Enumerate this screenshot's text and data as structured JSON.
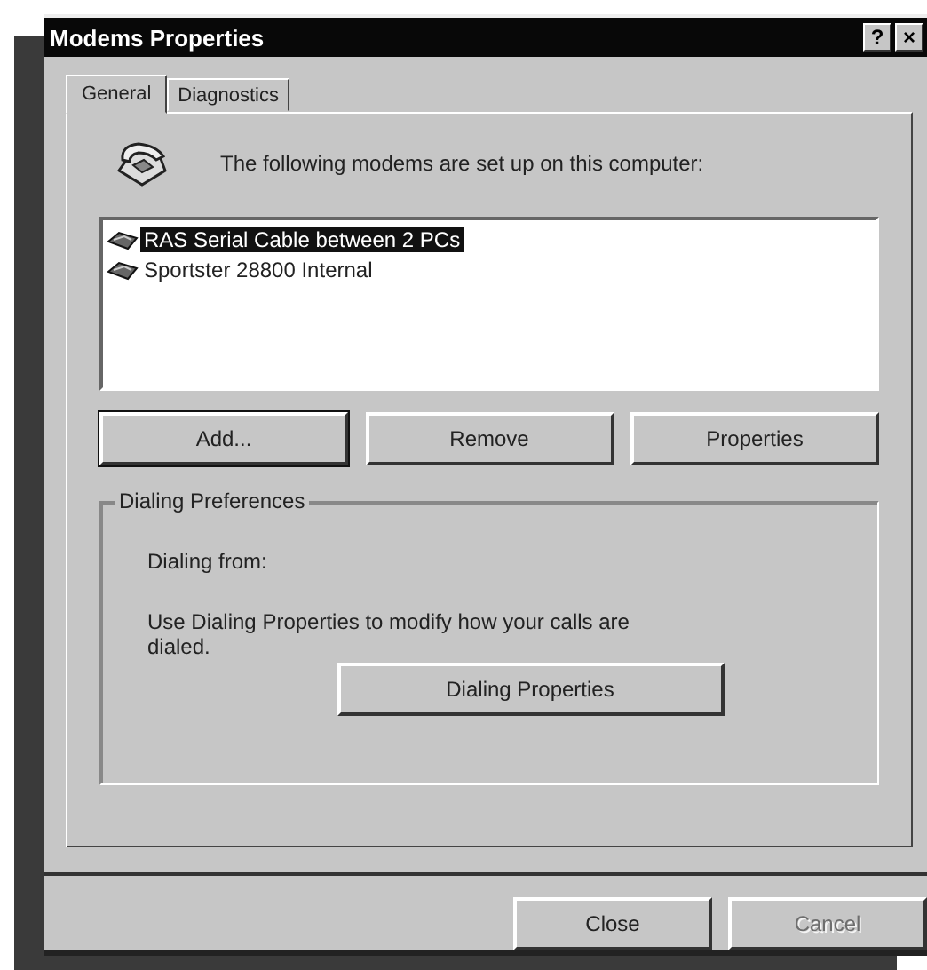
{
  "window": {
    "title": "Modems Properties",
    "title_buttons": [
      "?",
      "×"
    ]
  },
  "tabs": [
    {
      "label": "General",
      "selected": true
    },
    {
      "label": "Diagnostics",
      "selected": false
    }
  ],
  "intro": "The following modems are set up on this computer:",
  "modems": [
    {
      "name": "RAS Serial Cable between 2 PCs",
      "selected": true
    },
    {
      "name": "Sportster 28800 Internal",
      "selected": false
    }
  ],
  "list_buttons": [
    {
      "label": "Add...",
      "focused": true
    },
    {
      "label": "Remove",
      "focused": false
    },
    {
      "label": "Properties",
      "focused": false
    }
  ],
  "dialing_preferences": {
    "title": "Dialing Preferences",
    "dialing_from": "Dialing from:",
    "hint": "Use Dialing Properties to modify how your calls are dialed.",
    "button": "Dialing Properties"
  },
  "footer_buttons": [
    {
      "label": "Close",
      "disabled": false
    },
    {
      "label": "Cancel",
      "disabled": true
    }
  ]
}
